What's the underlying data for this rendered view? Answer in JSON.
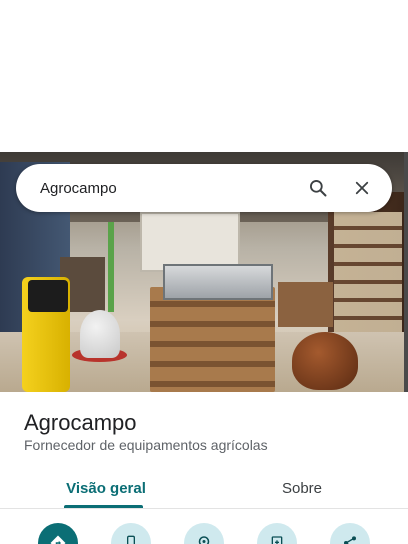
{
  "search": {
    "query": "Agrocampo",
    "search_icon": "search-icon",
    "close_icon": "close-icon"
  },
  "place": {
    "name": "Agrocampo",
    "category": "Fornecedor de equipamentos agrícolas"
  },
  "tabs": [
    {
      "label": "Visão geral",
      "selected": true
    },
    {
      "label": "Sobre",
      "selected": false
    }
  ],
  "actions": [
    {
      "icon": "directions-icon"
    },
    {
      "icon": "phone-icon"
    },
    {
      "icon": "location-icon"
    },
    {
      "icon": "save-icon"
    },
    {
      "icon": "share-icon"
    }
  ],
  "colors": {
    "accent": "#0b6e75",
    "action_bg": "#cfe9ee"
  }
}
